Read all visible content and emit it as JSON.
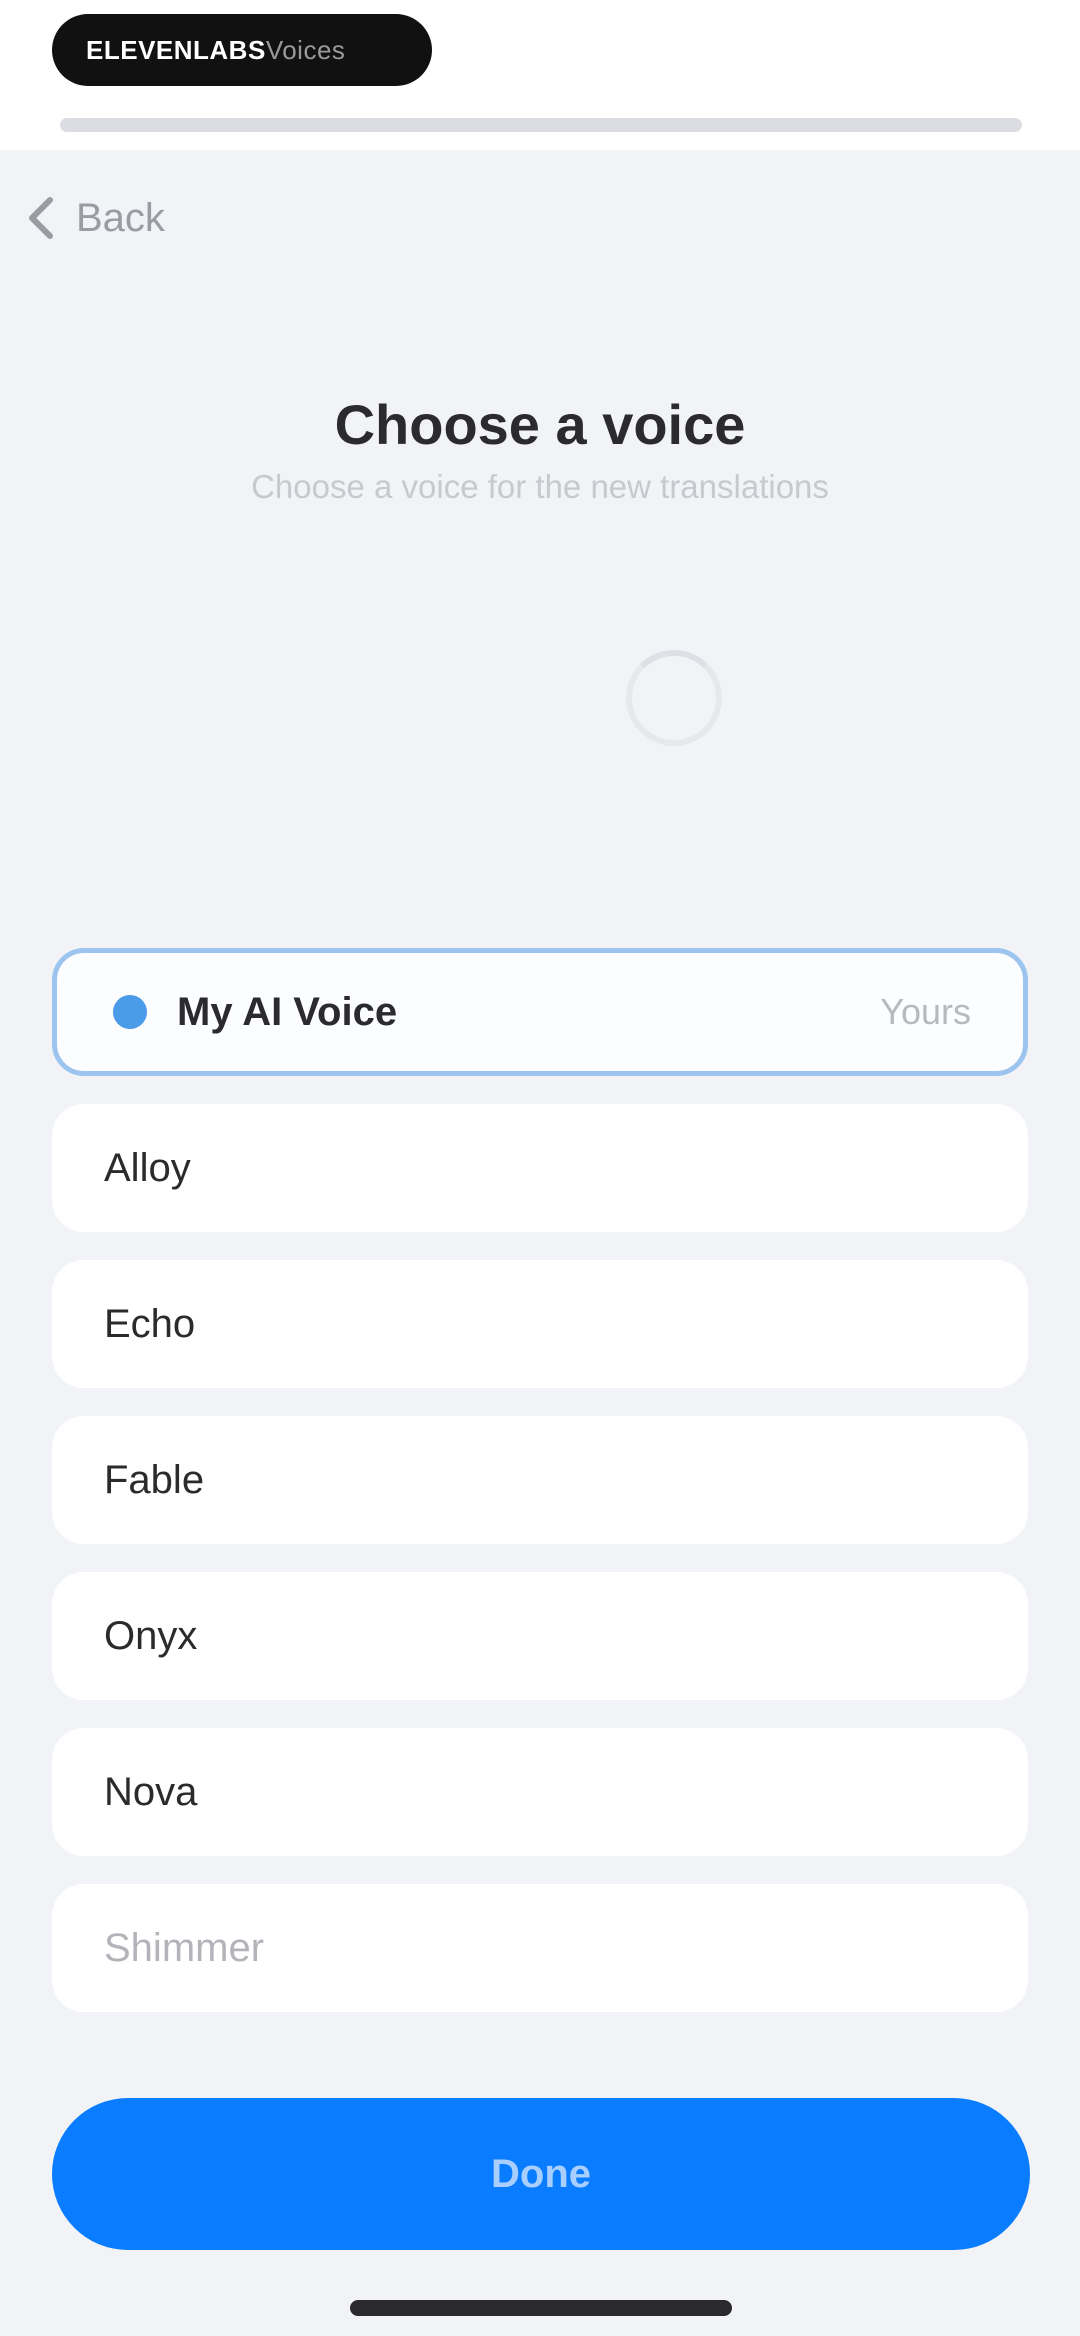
{
  "status_pill": {
    "primary": "ELEVENLABS",
    "secondary": "Voices"
  },
  "header": {
    "back_label": "Back"
  },
  "page": {
    "title": "Choose a voice",
    "subtitle": "Choose a voice for the new translations"
  },
  "voices": [
    {
      "name": "My AI Voice",
      "tag": "Yours",
      "selected": true
    },
    {
      "name": "Alloy"
    },
    {
      "name": "Echo"
    },
    {
      "name": "Fable"
    },
    {
      "name": "Onyx"
    },
    {
      "name": "Nova"
    },
    {
      "name": "Shimmer"
    }
  ],
  "footer": {
    "done_label": "Done"
  },
  "colors": {
    "accent": "#0a7cff",
    "selected_border": "#9cc4ef",
    "selected_dot": "#4a9be8",
    "background": "#f2f3f7"
  }
}
